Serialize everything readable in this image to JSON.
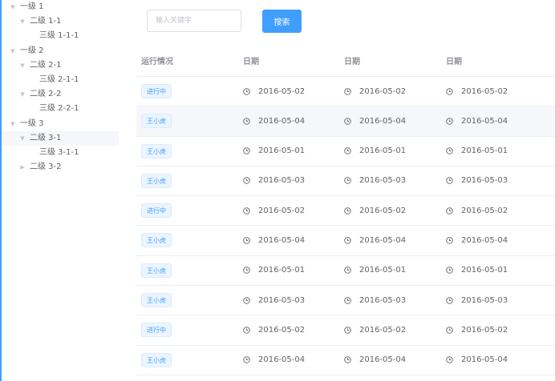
{
  "tree": [
    {
      "label": "一级 1",
      "level": 0,
      "arrow": "down"
    },
    {
      "label": "二级 1-1",
      "level": 1,
      "arrow": "down"
    },
    {
      "label": "三级 1-1-1",
      "level": 2,
      "arrow": "none"
    },
    {
      "label": "一级 2",
      "level": 0,
      "arrow": "down"
    },
    {
      "label": "二级 2-1",
      "level": 1,
      "arrow": "down"
    },
    {
      "label": "三级 2-1-1",
      "level": 2,
      "arrow": "none"
    },
    {
      "label": "二级 2-2",
      "level": 1,
      "arrow": "down"
    },
    {
      "label": "三级 2-2-1",
      "level": 2,
      "arrow": "none"
    },
    {
      "label": "一级 3",
      "level": 0,
      "arrow": "down"
    },
    {
      "label": "二级 3-1",
      "level": 1,
      "arrow": "down",
      "active": true
    },
    {
      "label": "三级 3-1-1",
      "level": 2,
      "arrow": "none"
    },
    {
      "label": "二级 3-2",
      "level": 1,
      "arrow": "right"
    }
  ],
  "search": {
    "placeholder": "输入关键字",
    "button_label": "搜索"
  },
  "table": {
    "headers": [
      "运行情况",
      "日期",
      "日期",
      "日期"
    ],
    "rows": [
      {
        "tag": "进行中",
        "dates": [
          "2016-05-02",
          "2016-05-02",
          "2016-05-02"
        ]
      },
      {
        "tag": "王小虎",
        "dates": [
          "2016-05-04",
          "2016-05-04",
          "2016-05-04"
        ],
        "hover": true
      },
      {
        "tag": "王小虎",
        "dates": [
          "2016-05-01",
          "2016-05-01",
          "2016-05-01"
        ]
      },
      {
        "tag": "王小虎",
        "dates": [
          "2016-05-03",
          "2016-05-03",
          "2016-05-03"
        ]
      },
      {
        "tag": "进行中",
        "dates": [
          "2016-05-02",
          "2016-05-02",
          "2016-05-02"
        ]
      },
      {
        "tag": "王小虎",
        "dates": [
          "2016-05-04",
          "2016-05-04",
          "2016-05-04"
        ]
      },
      {
        "tag": "王小虎",
        "dates": [
          "2016-05-01",
          "2016-05-01",
          "2016-05-01"
        ]
      },
      {
        "tag": "王小虎",
        "dates": [
          "2016-05-03",
          "2016-05-03",
          "2016-05-03"
        ]
      },
      {
        "tag": "进行中",
        "dates": [
          "2016-05-02",
          "2016-05-02",
          "2016-05-02"
        ]
      },
      {
        "tag": "王小虎",
        "dates": [
          "2016-05-04",
          "2016-05-04",
          "2016-05-04"
        ]
      }
    ]
  },
  "colors": {
    "accent": "#409eff",
    "tag_background": "#ecf5ff",
    "row_hover": "#f5f7fa"
  },
  "icons": {
    "tree_expanded": "caret-down-icon",
    "tree_collapsed": "caret-right-icon",
    "date": "clock-icon"
  }
}
